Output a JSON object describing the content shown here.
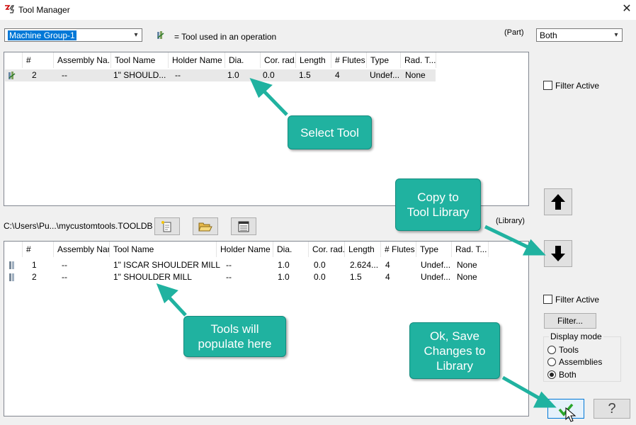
{
  "window": {
    "title": "Tool Manager",
    "close_glyph": "✕"
  },
  "top": {
    "machine_group": "Machine Group-1",
    "legend_text": "= Tool used in an operation",
    "part_label": "(Part)",
    "both_select": "Both",
    "filter_active_label": "Filter Active"
  },
  "part_table": {
    "headers": [
      "#",
      "Assembly Na...",
      "Tool Name",
      "Holder Name",
      "Dia.",
      "Cor. rad.",
      "Length",
      "# Flutes",
      "Type",
      "Rad. T..."
    ],
    "rows": [
      [
        "2",
        "--",
        "1\" SHOULD...",
        "--",
        "1.0",
        "0.0",
        "1.5",
        "4",
        "Undef...",
        "None"
      ]
    ]
  },
  "library": {
    "path": "C:\\Users\\Pu...\\mycustomtools.TOOLDB",
    "label": "(Library)",
    "filter_active_label": "Filter Active",
    "filter_button": "Filter...",
    "display_mode_label": "Display mode",
    "display_options": [
      "Tools",
      "Assemblies",
      "Both"
    ],
    "display_selected": "Both"
  },
  "library_table": {
    "headers": [
      "#",
      "Assembly Name",
      "Tool Name",
      "Holder Name",
      "Dia.",
      "Cor. rad.",
      "Length",
      "# Flutes",
      "Type",
      "Rad. T..."
    ],
    "rows": [
      [
        "1",
        "--",
        "1\" ISCAR SHOULDER MILL",
        "--",
        "1.0",
        "0.0",
        "2.624...",
        "4",
        "Undef...",
        "None"
      ],
      [
        "2",
        "--",
        "1\" SHOULDER MILL",
        "--",
        "1.0",
        "0.0",
        "1.5",
        "4",
        "Undef...",
        "None"
      ]
    ]
  },
  "callouts": {
    "select_tool": "Select Tool",
    "copy_to_library": "Copy to\nTool Library",
    "tools_populate": "Tools will\npopulate here",
    "ok_save": "Ok, Save\nChanges to\nLibrary"
  },
  "colors": {
    "callout": "#20b2a0",
    "selected_row": "#e8e8e8",
    "ok_check": "#2aa52a"
  }
}
